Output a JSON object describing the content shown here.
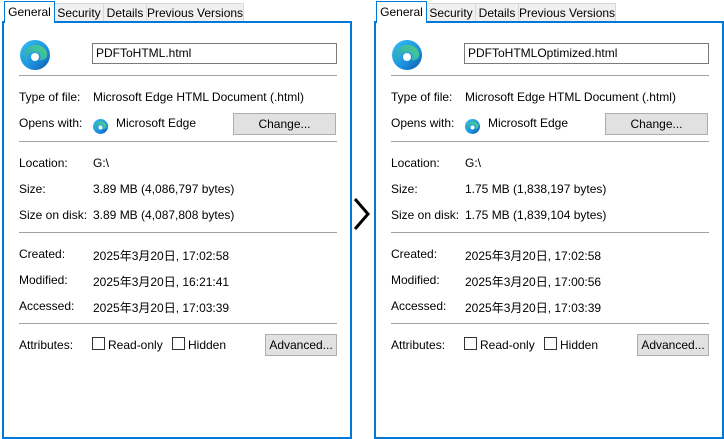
{
  "tabs": [
    "General",
    "Security",
    "Details",
    "Previous Versions"
  ],
  "labels": {
    "type": "Type of file:",
    "opens": "Opens with:",
    "location": "Location:",
    "size": "Size:",
    "size_on_disk": "Size on disk:",
    "created": "Created:",
    "modified": "Modified:",
    "accessed": "Accessed:",
    "attributes": "Attributes:"
  },
  "buttons": {
    "change": "Change...",
    "advanced": "Advanced..."
  },
  "attributes": {
    "readonly": "Read-only",
    "hidden": "Hidden"
  },
  "icons": {
    "app": "edge-icon",
    "arrow": "chevron-right-icon"
  },
  "colors": {
    "accent": "#0078d7"
  },
  "left": {
    "filename": "PDFToHTML.html",
    "type": "Microsoft Edge HTML Document (.html)",
    "opens": "Microsoft Edge",
    "location": "G:\\",
    "size": "3.89 MB (4,086,797 bytes)",
    "size_on_disk": "3.89 MB (4,087,808 bytes)",
    "created": "2025年3月20日, 17:02:58",
    "modified": "2025年3月20日, 16:21:41",
    "accessed": "2025年3月20日, 17:03:39"
  },
  "right": {
    "filename": "PDFToHTMLOptimized.html",
    "type": "Microsoft Edge HTML Document (.html)",
    "opens": "Microsoft Edge",
    "location": "G:\\",
    "size": "1.75 MB (1,838,197 bytes)",
    "size_on_disk": "1.75 MB (1,839,104 bytes)",
    "created": "2025年3月20日, 17:02:58",
    "modified": "2025年3月20日, 17:00:56",
    "accessed": "2025年3月20日, 17:03:39"
  }
}
